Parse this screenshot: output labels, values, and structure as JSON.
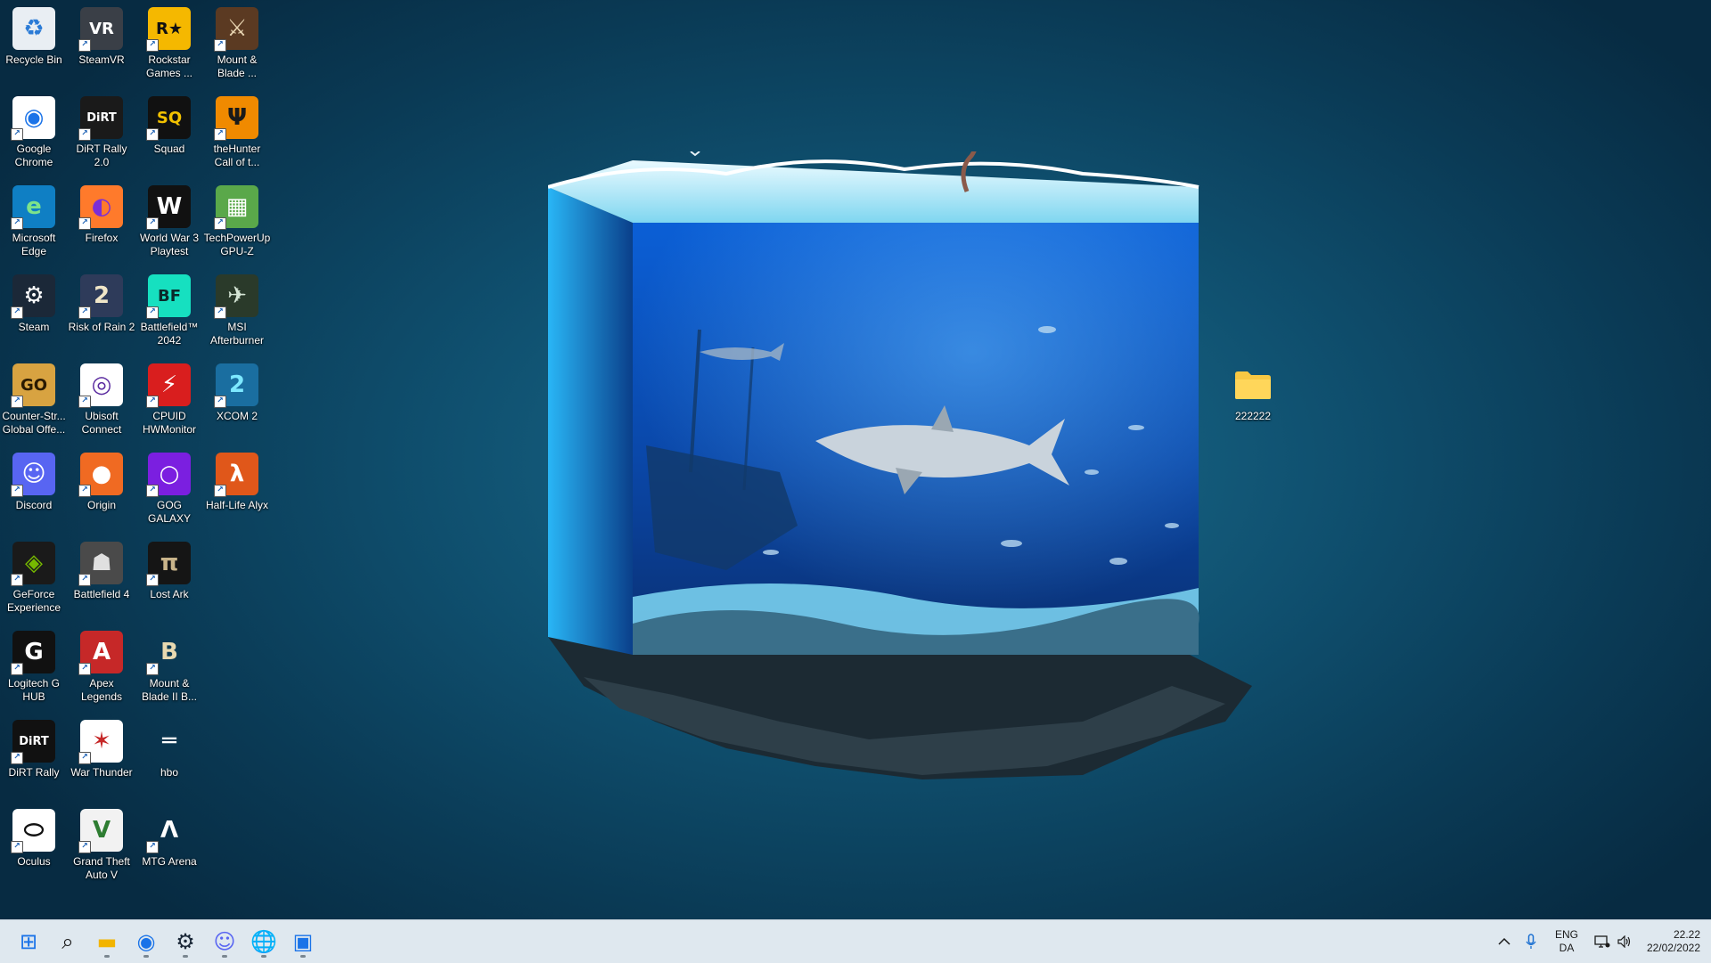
{
  "desktop": {
    "icons": [
      {
        "label": "Recycle Bin",
        "icon": "recycle-bin-icon",
        "bg": "#e9eef3",
        "fg": "#2b7bd6",
        "glyph": "♻",
        "shortcut": false
      },
      {
        "label": "SteamVR",
        "icon": "steamvr-icon",
        "bg": "#3a3f47",
        "fg": "#ffffff",
        "glyph": "VR",
        "shortcut": true
      },
      {
        "label": "Rockstar Games ...",
        "icon": "rockstar-games-icon",
        "bg": "#f5b800",
        "fg": "#111111",
        "glyph": "R★",
        "shortcut": true
      },
      {
        "label": "Mount & Blade ...",
        "icon": "mount-and-blade-icon",
        "bg": "#5b3a22",
        "fg": "#e7d3b0",
        "glyph": "⚔",
        "shortcut": true
      },
      {
        "label": "Google Chrome",
        "icon": "chrome-icon",
        "bg": "#ffffff",
        "fg": "#1a73e8",
        "glyph": "◉",
        "shortcut": true
      },
      {
        "label": "DiRT Rally 2.0",
        "icon": "dirt-rally-2-icon",
        "bg": "#1a1a1a",
        "fg": "#ffffff",
        "glyph": "DiRT",
        "shortcut": true
      },
      {
        "label": "Squad",
        "icon": "squad-icon",
        "bg": "#111111",
        "fg": "#f2c100",
        "glyph": "SQ",
        "shortcut": true
      },
      {
        "label": "theHunter Call of t...",
        "icon": "thehunter-icon",
        "bg": "#f08a00",
        "fg": "#1a1a1a",
        "glyph": "Ψ",
        "shortcut": true
      },
      {
        "label": "Microsoft Edge",
        "icon": "edge-icon",
        "bg": "#0f7fc4",
        "fg": "#7de38a",
        "glyph": "e",
        "shortcut": true
      },
      {
        "label": "Firefox",
        "icon": "firefox-icon",
        "bg": "#ff7a2b",
        "fg": "#7b2ed6",
        "glyph": "◐",
        "shortcut": true
      },
      {
        "label": "World War 3 Playtest",
        "icon": "world-war-3-icon",
        "bg": "#111111",
        "fg": "#ffffff",
        "glyph": "W",
        "shortcut": true
      },
      {
        "label": "TechPowerUp GPU-Z",
        "icon": "gpu-z-icon",
        "bg": "#5aa84a",
        "fg": "#ffffff",
        "glyph": "▦",
        "shortcut": true
      },
      {
        "label": "Steam",
        "icon": "steam-icon",
        "bg": "#1b2838",
        "fg": "#ffffff",
        "glyph": "⚙",
        "shortcut": true
      },
      {
        "label": "Risk of Rain 2",
        "icon": "risk-of-rain-2-icon",
        "bg": "#2e3b5a",
        "fg": "#f0e6c8",
        "glyph": "2",
        "shortcut": true
      },
      {
        "label": "Battlefield™ 2042",
        "icon": "battlefield-2042-icon",
        "bg": "#16e0c0",
        "fg": "#0a2a2a",
        "glyph": "BF",
        "shortcut": true
      },
      {
        "label": "MSI Afterburner",
        "icon": "msi-afterburner-icon",
        "bg": "#2a3a2a",
        "fg": "#d6e6d6",
        "glyph": "✈",
        "shortcut": true
      },
      {
        "label": "Counter-Str... Global Offe...",
        "icon": "csgo-icon",
        "bg": "#d8a341",
        "fg": "#2a1a00",
        "glyph": "GO",
        "shortcut": true
      },
      {
        "label": "Ubisoft Connect",
        "icon": "ubisoft-icon",
        "bg": "#ffffff",
        "fg": "#5b2ca0",
        "glyph": "◎",
        "shortcut": true
      },
      {
        "label": "CPUID HWMonitor",
        "icon": "hwmonitor-icon",
        "bg": "#d91e1e",
        "fg": "#ffffff",
        "glyph": "⚡",
        "shortcut": true
      },
      {
        "label": "XCOM 2",
        "icon": "xcom-2-icon",
        "bg": "#1a6ea0",
        "fg": "#7de8ff",
        "glyph": "2",
        "shortcut": true
      },
      {
        "label": "Discord",
        "icon": "discord-icon",
        "bg": "#5865f2",
        "fg": "#ffffff",
        "glyph": "☺",
        "shortcut": true
      },
      {
        "label": "Origin",
        "icon": "origin-icon",
        "bg": "#f06a22",
        "fg": "#ffffff",
        "glyph": "●",
        "shortcut": true
      },
      {
        "label": "GOG GALAXY",
        "icon": "gog-galaxy-icon",
        "bg": "#7b1fe0",
        "fg": "#ffffff",
        "glyph": "○",
        "shortcut": true
      },
      {
        "label": "Half-Life Alyx",
        "icon": "half-life-alyx-icon",
        "bg": "#e0571a",
        "fg": "#ffffff",
        "glyph": "λ",
        "shortcut": true
      },
      {
        "label": "GeForce Experience",
        "icon": "geforce-experience-icon",
        "bg": "#1a1a1a",
        "fg": "#76b900",
        "glyph": "◈",
        "shortcut": true
      },
      {
        "label": "Battlefield 4",
        "icon": "battlefield-4-icon",
        "bg": "#4a4a4a",
        "fg": "#e0e0e0",
        "glyph": "☗",
        "shortcut": true
      },
      {
        "label": "Lost Ark",
        "icon": "lost-ark-icon",
        "bg": "#151515",
        "fg": "#c9b48a",
        "glyph": "π",
        "shortcut": true
      },
      {
        "label": "",
        "icon": "empty-slot",
        "bg": "transparent",
        "fg": "transparent",
        "glyph": "",
        "shortcut": false
      },
      {
        "label": "Logitech G HUB",
        "icon": "logitech-g-hub-icon",
        "bg": "#111111",
        "fg": "#ffffff",
        "glyph": "G",
        "shortcut": true
      },
      {
        "label": "Apex Legends",
        "icon": "apex-legends-icon",
        "bg": "#c62828",
        "fg": "#ffffff",
        "glyph": "A",
        "shortcut": true
      },
      {
        "label": "Mount & Blade II B...",
        "icon": "bannerlord-icon",
        "bg": "transparent",
        "fg": "#e8d9b0",
        "glyph": "B",
        "shortcut": true
      },
      {
        "label": "",
        "icon": "empty-slot",
        "bg": "transparent",
        "fg": "transparent",
        "glyph": "",
        "shortcut": false
      },
      {
        "label": "DiRT Rally",
        "icon": "dirt-rally-icon",
        "bg": "#111111",
        "fg": "#ffffff",
        "glyph": "DiRT",
        "shortcut": true
      },
      {
        "label": "War Thunder",
        "icon": "war-thunder-icon",
        "bg": "#ffffff",
        "fg": "#c62828",
        "glyph": "✶",
        "shortcut": true
      },
      {
        "label": "hbo",
        "icon": "hbo-icon",
        "bg": "transparent",
        "fg": "#ffffff",
        "glyph": "═",
        "shortcut": false
      },
      {
        "label": "",
        "icon": "empty-slot",
        "bg": "transparent",
        "fg": "transparent",
        "glyph": "",
        "shortcut": false
      },
      {
        "label": "Oculus",
        "icon": "oculus-icon",
        "bg": "#ffffff",
        "fg": "#111111",
        "glyph": "⬭",
        "shortcut": true
      },
      {
        "label": "Grand Theft Auto V",
        "icon": "gta-v-icon",
        "bg": "#f2f2f2",
        "fg": "#2e7d32",
        "glyph": "V",
        "shortcut": true
      },
      {
        "label": "MTG Arena",
        "icon": "mtg-arena-icon",
        "bg": "transparent",
        "fg": "#ffffff",
        "glyph": "Λ",
        "shortcut": true
      }
    ],
    "folder": {
      "label": "222222",
      "icon": "folder-icon",
      "color": "#f7c843"
    }
  },
  "taskbar": {
    "items": [
      {
        "name": "start-button",
        "icon": "windows-logo-icon",
        "glyph": "⊞",
        "color": "#1a73e8",
        "running": false
      },
      {
        "name": "search-button",
        "icon": "search-icon",
        "glyph": "⌕",
        "color": "#1a1a1a",
        "running": false
      },
      {
        "name": "file-explorer-button",
        "icon": "folder-icon",
        "glyph": "▬",
        "color": "#f2b400",
        "running": true
      },
      {
        "name": "chrome-taskbar-button",
        "icon": "chrome-icon",
        "glyph": "◉",
        "color": "#1a73e8",
        "running": true
      },
      {
        "name": "steam-taskbar-button",
        "icon": "steam-icon",
        "glyph": "⚙",
        "color": "#1b2838",
        "running": true
      },
      {
        "name": "discord-taskbar-button",
        "icon": "discord-icon",
        "glyph": "☺",
        "color": "#5865f2",
        "running": true
      },
      {
        "name": "globe-app-taskbar-button",
        "icon": "globe-icon",
        "glyph": "🌐",
        "color": "#2e7d32",
        "running": true
      },
      {
        "name": "photos-taskbar-button",
        "icon": "photos-icon",
        "glyph": "▣",
        "color": "#1a73e8",
        "running": true
      }
    ],
    "tray": {
      "overflow_icon": "chevron-up-icon",
      "mic_icon": "microphone-icon",
      "lang_top": "ENG",
      "lang_bottom": "DA",
      "network_icon": "network-icon",
      "volume_icon": "speaker-icon",
      "time": "22.22",
      "date": "22/02/2022"
    }
  },
  "colors": {
    "taskbar": "#dfe8ef",
    "accent": "#1a73e8",
    "wallpaper_dark": "#072b42",
    "wallpaper_light": "#1b6e8f"
  }
}
